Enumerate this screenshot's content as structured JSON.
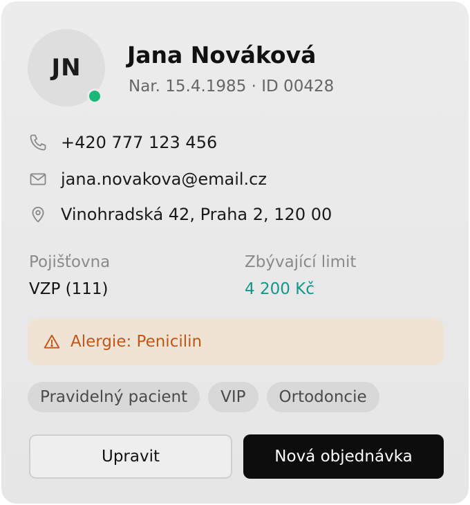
{
  "patient": {
    "initials": "JN",
    "name": "Jana Nováková",
    "meta": "Nar. 15.4.1985 · ID 00428",
    "status_color": "#18b877"
  },
  "contact": {
    "phone": {
      "icon": "phone-icon",
      "value": "+420 777 123 456"
    },
    "email": {
      "icon": "mail-icon",
      "value": "jana.novakova@email.cz"
    },
    "address": {
      "icon": "location-pin-icon",
      "value": "Vinohradská 42, Praha 2, 120 00"
    }
  },
  "fields": {
    "insurance": {
      "label": "Pojišťovna",
      "value": "VZP (111)"
    },
    "limit": {
      "label": "Zbývající limit",
      "value": "4 200 Kč",
      "color": "#14968a"
    }
  },
  "allergy": {
    "icon": "warning-icon",
    "text": "Alergie: Penicilin",
    "color": "#c0561a",
    "background": "#efe3d3"
  },
  "tags": [
    "Pravidelný pacient",
    "VIP",
    "Ortodoncie"
  ],
  "actions": {
    "edit_label": "Upravit",
    "new_order_label": "Nová objednávka"
  }
}
